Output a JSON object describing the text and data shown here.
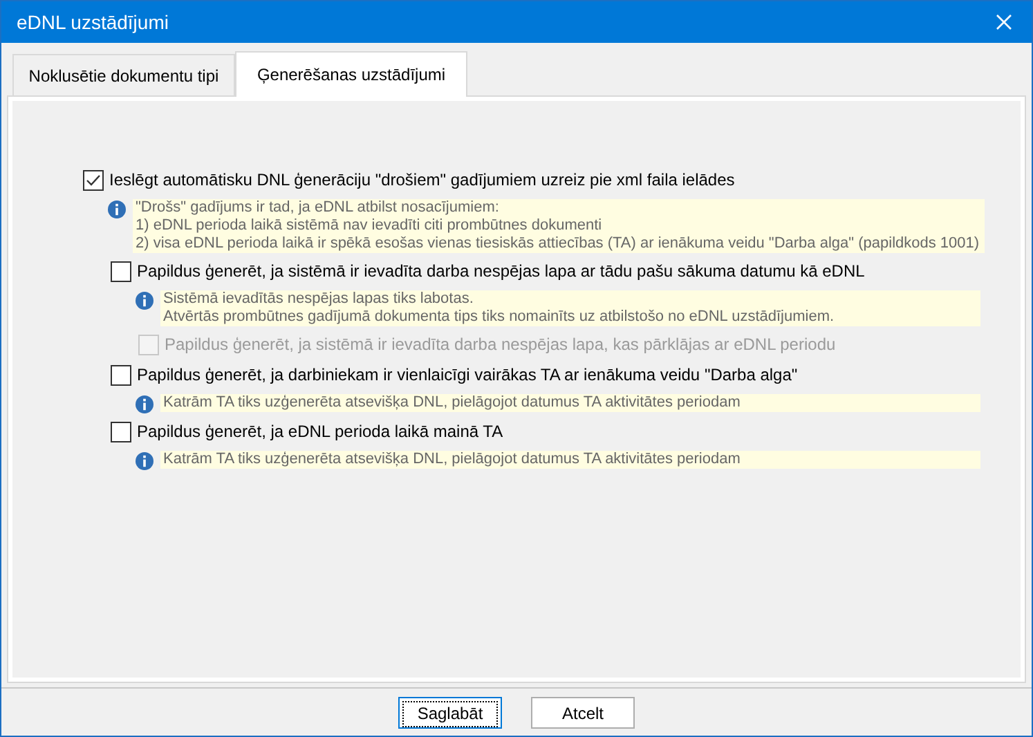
{
  "window": {
    "title": "eDNL uzstādījumi"
  },
  "tabs": [
    {
      "label": "Noklusētie dokumentu tipi",
      "selected": false
    },
    {
      "label": "Ģenerēšanas uzstādījumi",
      "selected": true
    }
  ],
  "options": [
    {
      "label": "Ieslēgt automātisku DNL ģenerāciju \"drošiem\" gadījumiem uzreiz pie xml faila ielādes",
      "checked": true,
      "disabled": false,
      "note": [
        "\"Drošs\" gadījums ir tad, ja eDNL atbilst nosacījumiem:",
        "1) eDNL perioda laikā sistēmā nav ievadīti citi prombūtnes dokumenti",
        "2) visa eDNL perioda laikā ir spēkā esošas vienas tiesiskās attiecības (TA) ar ienākuma veidu \"Darba alga\" (papildkods 1001)"
      ],
      "children": [
        {
          "label": "Papildus ģenerēt, ja sistēmā ir ievadīta darba nespējas lapa ar tādu pašu sākuma datumu kā eDNL",
          "checked": false,
          "disabled": false,
          "note": [
            "Sistēmā ievadītās nespējas lapas tiks labotas.",
            "Atvērtās prombūtnes gadījumā dokumenta tips tiks nomainīts uz atbilstošo no eDNL uzstādījumiem."
          ],
          "children": [
            {
              "label": "Papildus ģenerēt, ja sistēmā ir ievadīta darba nespējas lapa, kas pārklājas ar eDNL periodu",
              "checked": false,
              "disabled": true
            }
          ]
        },
        {
          "label": "Papildus ģenerēt, ja darbiniekam ir vienlaicīgi vairākas TA ar ienākuma veidu \"Darba alga\"",
          "checked": false,
          "disabled": false,
          "note": [
            "Katrām TA tiks uzģenerēta atsevišķa DNL, pielāgojot datumus TA aktivitātes periodam"
          ]
        },
        {
          "label": "Papildus ģenerēt, ja eDNL perioda laikā mainā TA",
          "checked": false,
          "disabled": false,
          "note": [
            "Katrām TA tiks uzģenerēta atsevišķa DNL, pielāgojot datumus TA aktivitātes periodam"
          ]
        }
      ]
    }
  ],
  "buttons": [
    {
      "label": "Saglabāt",
      "selected": true
    },
    {
      "label": "Atcelt",
      "selected": false
    }
  ]
}
